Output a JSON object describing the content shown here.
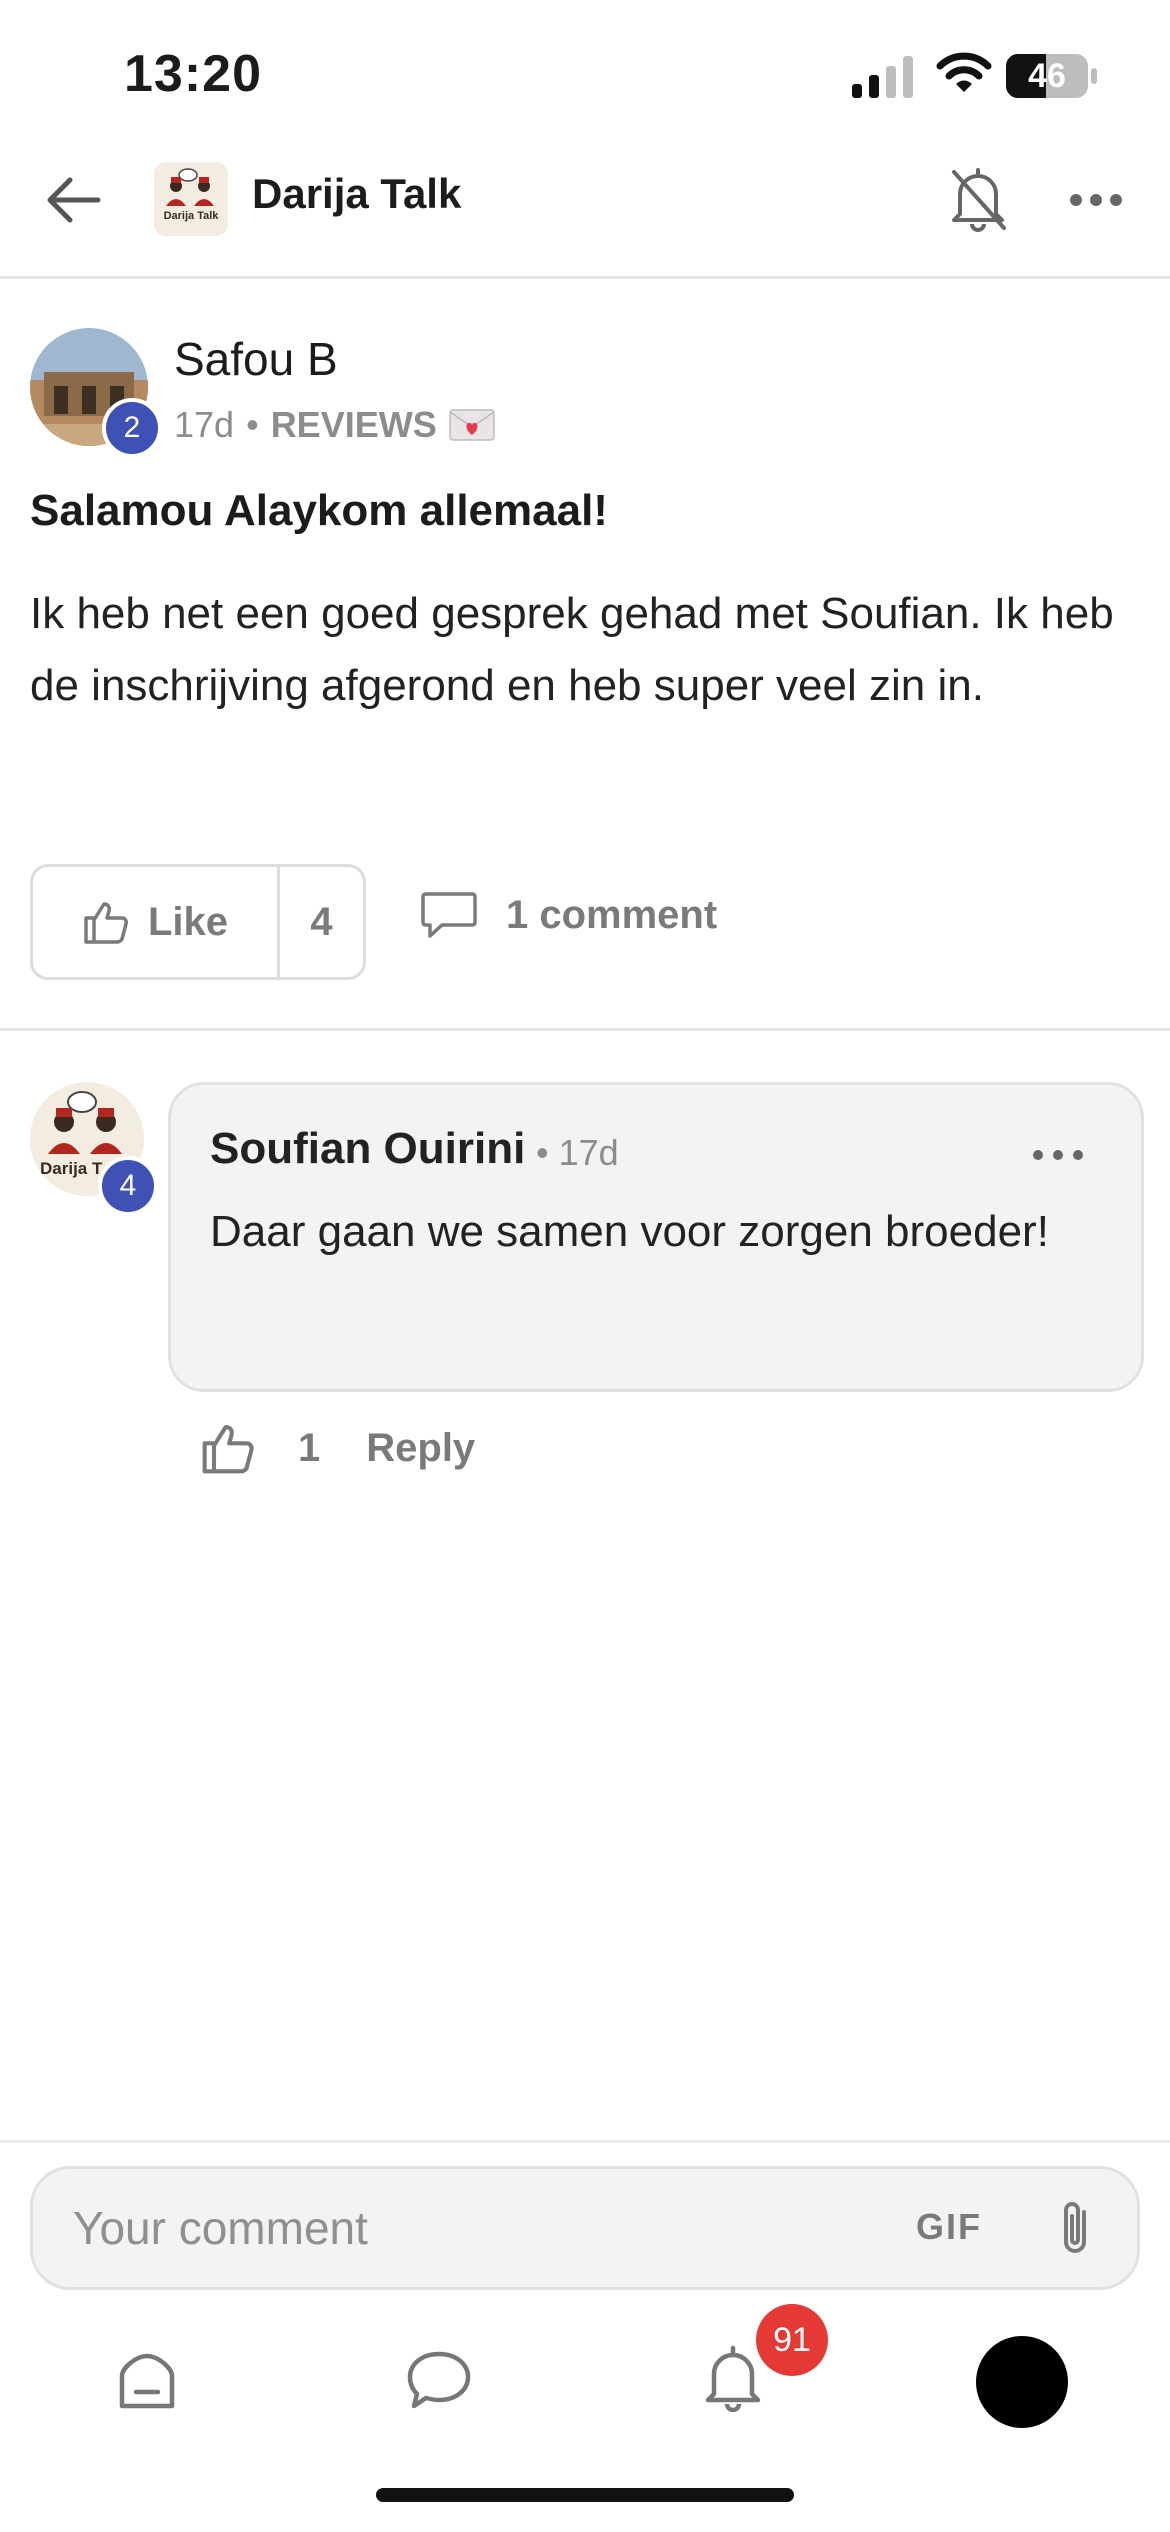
{
  "status_bar": {
    "time": "13:20",
    "battery": "46"
  },
  "header": {
    "group_name": "Darija Talk",
    "logo_text": "Darija Talk"
  },
  "post": {
    "author": "Safou B",
    "level": "2",
    "age": "17d",
    "separator": "•",
    "category": "REVIEWS",
    "title": "Salamou Alaykom allemaal!",
    "body": "Ik heb net een goed gesprek gehad met Soufian. Ik heb de inschrijving afgerond en heb super veel zin in.",
    "like_label": "Like",
    "like_count": "4",
    "comment_label": "1 comment"
  },
  "comment": {
    "author": "Soufian Ouirini",
    "time": "• 17d",
    "level": "4",
    "body": "Daar gaan we samen voor zorgen broeder!",
    "like_count": "1",
    "reply_label": "Reply"
  },
  "composer": {
    "placeholder": "Your comment",
    "gif_label": "GIF"
  },
  "bottom_nav": {
    "notification_count": "91"
  },
  "colors": {
    "level_badge": "#3f51b5",
    "notification_badge": "#e53935",
    "muted_text": "#8c8c8c"
  }
}
